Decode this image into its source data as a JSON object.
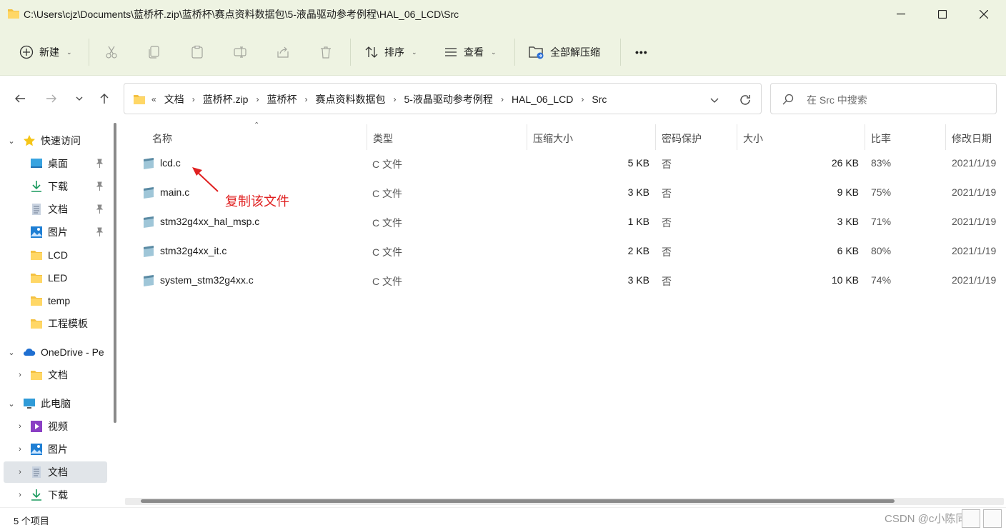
{
  "window": {
    "title": "C:\\Users\\cjz\\Documents\\蓝桥杯.zip\\蓝桥杯\\赛点资料数据包\\5-液晶驱动参考例程\\HAL_06_LCD\\Src"
  },
  "toolbar": {
    "new_label": "新建",
    "sort_label": "排序",
    "view_label": "查看",
    "extract_label": "全部解压缩",
    "more_label": "•••"
  },
  "address": {
    "overflow": "«",
    "crumbs": [
      "文档",
      "蓝桥杯.zip",
      "蓝桥杯",
      "赛点资料数据包",
      "5-液晶驱动参考例程",
      "HAL_06_LCD",
      "Src"
    ]
  },
  "search": {
    "placeholder": "在 Src 中搜索"
  },
  "sidebar": {
    "quick_access": "快速访问",
    "quick_items": [
      "桌面",
      "下载",
      "文档",
      "图片",
      "LCD",
      "LED",
      "temp",
      "工程模板"
    ],
    "onedrive": "OneDrive - Pe",
    "onedrive_items": [
      "文档"
    ],
    "this_pc": "此电脑",
    "pc_items": [
      "视频",
      "图片",
      "文档",
      "下载"
    ]
  },
  "columns": {
    "name": "名称",
    "type": "类型",
    "compressed": "压缩大小",
    "password": "密码保护",
    "size": "大小",
    "ratio": "比率",
    "modified": "修改日期"
  },
  "files": [
    {
      "name": "lcd.c",
      "type": "C 文件",
      "compressed": "5 KB",
      "password": "否",
      "size": "26 KB",
      "ratio": "83%",
      "modified": "2021/1/19"
    },
    {
      "name": "main.c",
      "type": "C 文件",
      "compressed": "3 KB",
      "password": "否",
      "size": "9 KB",
      "ratio": "75%",
      "modified": "2021/1/19"
    },
    {
      "name": "stm32g4xx_hal_msp.c",
      "type": "C 文件",
      "compressed": "1 KB",
      "password": "否",
      "size": "3 KB",
      "ratio": "71%",
      "modified": "2021/1/19"
    },
    {
      "name": "stm32g4xx_it.c",
      "type": "C 文件",
      "compressed": "2 KB",
      "password": "否",
      "size": "6 KB",
      "ratio": "80%",
      "modified": "2021/1/19"
    },
    {
      "name": "system_stm32g4xx.c",
      "type": "C 文件",
      "compressed": "3 KB",
      "password": "否",
      "size": "10 KB",
      "ratio": "74%",
      "modified": "2021/1/19"
    }
  ],
  "annotation": "复制该文件",
  "status": {
    "count": "5 个项目",
    "watermark": "CSDN @c小陈同学"
  },
  "colors": {
    "annotation": "#e02020",
    "selection": "#e1e5e9",
    "chrome": "#eef3e2"
  }
}
